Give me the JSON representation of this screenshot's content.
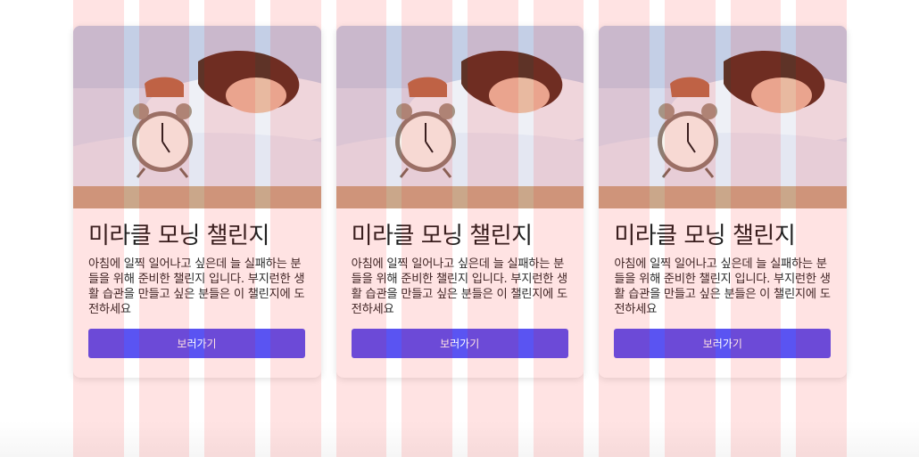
{
  "cards": [
    {
      "image_alt": "alarm clock and sleeping person",
      "title": "미라클 모닝 챌린지",
      "description": "아침에 일찍 일어나고 싶은데 늘 실패하는 분들을 위해 준비한 챌린지 입니다. 부지런한 생활 습관을 만들고 싶은 분들은 이 챌린지에 도전하세요",
      "button_label": "보러가기"
    },
    {
      "image_alt": "alarm clock and sleeping person",
      "title": "미라클 모닝 챌린지",
      "description": "아침에 일찍 일어나고 싶은데 늘 실패하는 분들을 위해 준비한 챌린지 입니다. 부지런한 생활 습관을 만들고 싶은 분들은 이 챌린지에 도전하세요",
      "button_label": "보러가기"
    },
    {
      "image_alt": "alarm clock and sleeping person",
      "title": "미라클 모닝 챌린지",
      "description": "아침에 일찍 일어나고 싶은데 늘 실패하는 분들을 위해 준비한 챌린지 입니다. 부지런한 생활 습관을 만들고 싶은 분들은 이 챌린지에 도전하세요",
      "button_label": "보러가기"
    }
  ],
  "colors": {
    "button": "#5a54f2",
    "grid_overlay": "rgba(255,0,0,0.11)"
  }
}
